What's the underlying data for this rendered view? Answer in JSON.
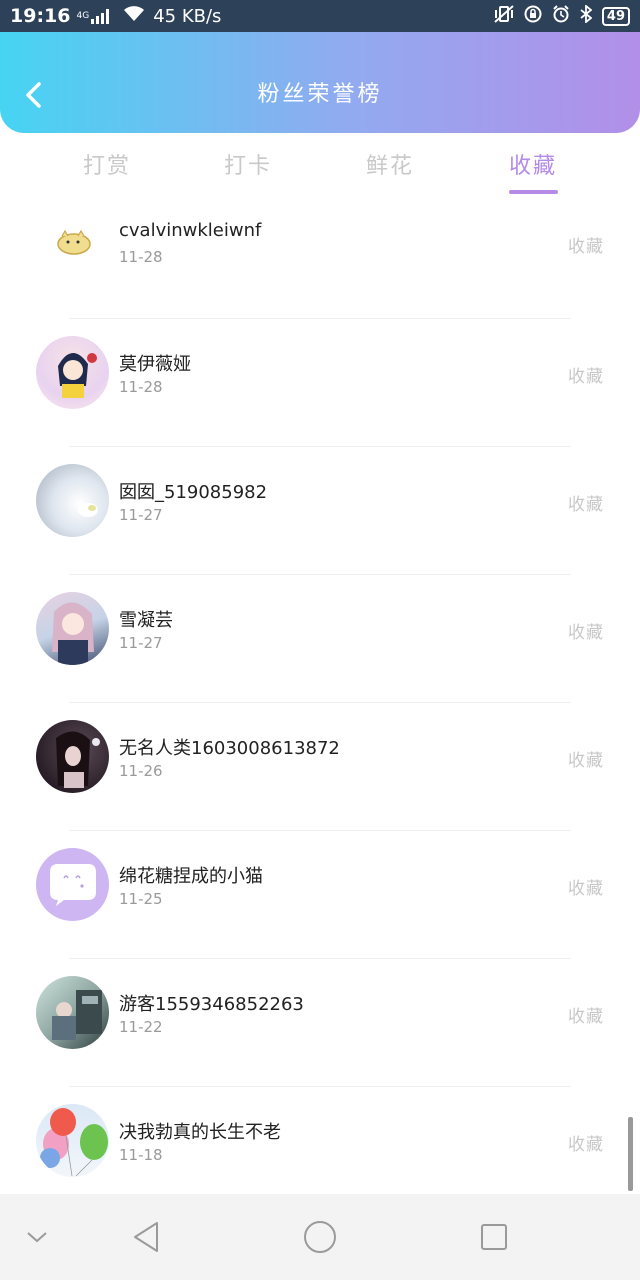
{
  "status_bar": {
    "time": "19:16",
    "network": "4G",
    "speed": "45 KB/s",
    "battery": "49"
  },
  "header": {
    "title": "粉丝荣誉榜",
    "back_icon": "chevron-left-icon"
  },
  "tabs": [
    {
      "label": "打赏",
      "active": false
    },
    {
      "label": "打卡",
      "active": false
    },
    {
      "label": "鲜花",
      "active": false
    },
    {
      "label": "收藏",
      "active": true
    }
  ],
  "rows": [
    {
      "name": "cvalvinwkleiwnf",
      "date": "11-28",
      "action": "收藏"
    },
    {
      "name": "莫伊薇娅",
      "date": "11-28",
      "action": "收藏"
    },
    {
      "name": "囡囡_519085982",
      "date": "11-27",
      "action": "收藏"
    },
    {
      "name": "雪凝芸",
      "date": "11-27",
      "action": "收藏"
    },
    {
      "name": "无名人类1603008613872",
      "date": "11-26",
      "action": "收藏"
    },
    {
      "name": "绵花糖捏成的小猫",
      "date": "11-25",
      "action": "收藏"
    },
    {
      "name": "游客1559346852263",
      "date": "11-22",
      "action": "收藏"
    },
    {
      "name": "决我勃真的长生不老",
      "date": "11-18",
      "action": "收藏"
    }
  ],
  "colors": {
    "accent": "#b48be6",
    "header_start": "#46d4f3",
    "header_end": "#b28fe8"
  }
}
